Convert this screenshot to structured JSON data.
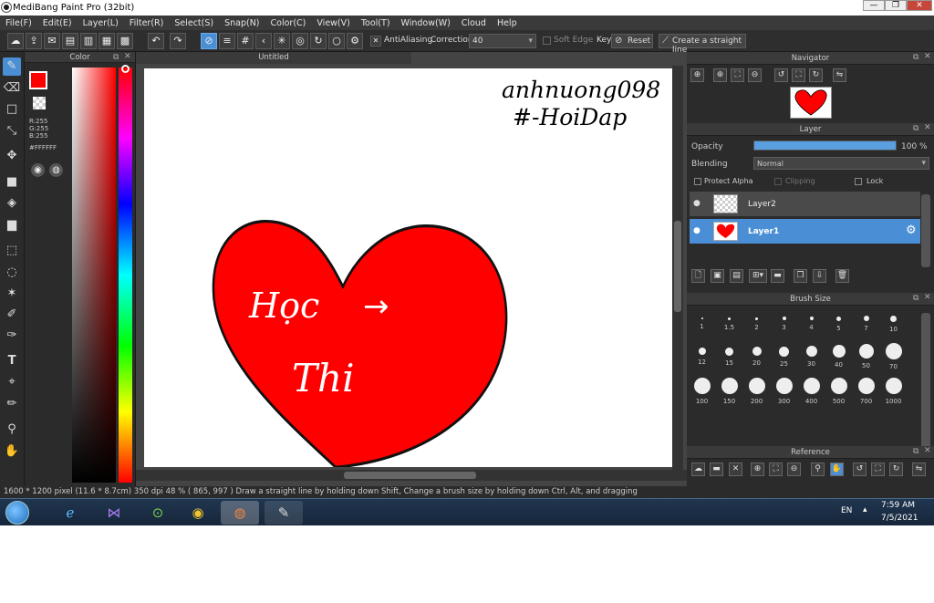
{
  "window": {
    "title": "MediBang Paint Pro (32bit)",
    "buttons": [
      "—",
      "❐",
      "✕"
    ]
  },
  "menu": [
    "File(F)",
    "Edit(E)",
    "Layer(L)",
    "Filter(R)",
    "Select(S)",
    "Snap(N)",
    "Color(C)",
    "View(V)",
    "Tool(T)",
    "Window(W)",
    "Cloud",
    "Help"
  ],
  "toolbar": {
    "antialiasing_label": "AntiAliasing",
    "correction_label": "Correction",
    "correction_value": "40",
    "soft_edge_label": "Soft Edge",
    "key_label": "Key",
    "reset_label": "Reset",
    "straight_line_label": "Create a straight line"
  },
  "color_panel": {
    "title": "Color",
    "primary_color": "#ff0000",
    "r": "R:255",
    "g": "G:255",
    "b": "B:255",
    "hex": "#FFFFFF"
  },
  "canvas": {
    "tab_title": "Untitled",
    "signature_line1": "anhnuong098",
    "signature_line2": "#-HoiDap",
    "heart_text1": "Học",
    "heart_text2": "Thi",
    "arrow": "→",
    "heart_color": "#ff0000"
  },
  "navigator": {
    "title": "Navigator"
  },
  "layer_panel": {
    "title": "Layer",
    "opacity_label": "Opacity",
    "opacity_value": "100 %",
    "opacity_fraction": 1.0,
    "blending_label": "Blending",
    "blending_value": "Normal",
    "protect_alpha_label": "Protect Alpha",
    "clipping_label": "Clipping",
    "lock_label": "Lock",
    "layers": [
      {
        "name": "Layer2",
        "selected": false
      },
      {
        "name": "Layer1",
        "selected": true
      }
    ]
  },
  "brush_size": {
    "title": "Brush Size",
    "sizes": [
      "1",
      "1.5",
      "2",
      "3",
      "4",
      "5",
      "7",
      "10",
      "12",
      "15",
      "20",
      "25",
      "30",
      "40",
      "50",
      "70",
      "100",
      "150",
      "200",
      "300",
      "400",
      "500",
      "700",
      "1000"
    ]
  },
  "reference": {
    "title": "Reference"
  },
  "status": {
    "text": "1600 * 1200 pixel   (11.6 * 8.7cm)   350 dpi   48 %   ( 865, 997 )   Draw a straight line by holding down Shift, Change a brush size by holding down Ctrl, Alt, and dragging"
  },
  "taskbar": {
    "lang": "EN",
    "time": "7:59 AM",
    "date": "7/5/2021"
  }
}
